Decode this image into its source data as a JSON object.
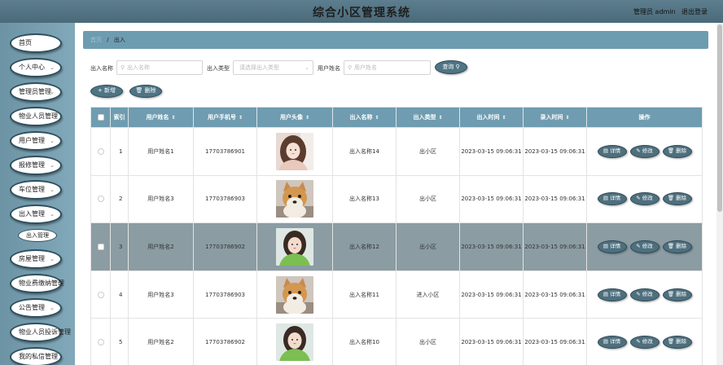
{
  "header": {
    "title": "综合小区管理系统",
    "admin_label": "管理员 admin",
    "logout_label": "退出登录"
  },
  "sidebar": {
    "items": [
      {
        "label": "首页",
        "has_chevron": false
      },
      {
        "label": "个人中心",
        "has_chevron": true
      },
      {
        "label": "管理员管理",
        "has_chevron": true
      },
      {
        "label": "物业人员管理",
        "has_chevron": false
      },
      {
        "label": "用户管理",
        "has_chevron": true
      },
      {
        "label": "报修管理",
        "has_chevron": true
      },
      {
        "label": "车位管理",
        "has_chevron": true
      },
      {
        "label": "出入管理",
        "has_chevron": true
      },
      {
        "label": "房屋管理",
        "has_chevron": true
      },
      {
        "label": "物业费缴纳管理",
        "has_chevron": false
      },
      {
        "label": "公告管理",
        "has_chevron": true
      },
      {
        "label": "物业人员投诉管理",
        "has_chevron": false
      },
      {
        "label": "我的私信管理",
        "has_chevron": false
      }
    ],
    "submenu": {
      "label": "出入管理"
    }
  },
  "breadcrumb": {
    "home": "首页",
    "sep": "/",
    "current": "出入"
  },
  "filters": {
    "name_label": "出入名称",
    "name_placeholder": "出入名称",
    "type_label": "出入类型",
    "type_placeholder": "请选择出入类型",
    "user_label": "用户姓名",
    "user_placeholder": "用户姓名",
    "query_label": "查询"
  },
  "actions": {
    "add_label": "新增",
    "delete_label": "删除"
  },
  "table": {
    "headers": [
      "索引",
      "用户姓名",
      "用户手机号",
      "用户头像",
      "出入名称",
      "出入类型",
      "出入时间",
      "录入时间",
      "操作"
    ],
    "detail_label": "详情",
    "edit_label": "修改",
    "delete_label": "删除",
    "rows": [
      {
        "index": "1",
        "name": "用户姓名1",
        "phone": "17703786901",
        "avatar": "girl",
        "inout_name": "出入名称14",
        "type": "出小区",
        "time": "2023-03-15 09:06:31",
        "record_time": "2023-03-15 09:06:31",
        "selected": false
      },
      {
        "index": "2",
        "name": "用户姓名3",
        "phone": "17703786903",
        "avatar": "dog",
        "inout_name": "出入名称13",
        "type": "出小区",
        "time": "2023-03-15 09:06:31",
        "record_time": "2023-03-15 09:06:31",
        "selected": false
      },
      {
        "index": "3",
        "name": "用户姓名2",
        "phone": "17703786902",
        "avatar": "girl-green",
        "inout_name": "出入名称12",
        "type": "出小区",
        "time": "2023-03-15 09:06:31",
        "record_time": "2023-03-15 09:06:31",
        "selected": true
      },
      {
        "index": "4",
        "name": "用户姓名3",
        "phone": "17703786903",
        "avatar": "dog",
        "inout_name": "出入名称11",
        "type": "进入小区",
        "time": "2023-03-15 09:06:31",
        "record_time": "2023-03-15 09:06:31",
        "selected": false
      },
      {
        "index": "5",
        "name": "用户姓名2",
        "phone": "17703786902",
        "avatar": "girl-green",
        "inout_name": "出入名称10",
        "type": "出小区",
        "time": "2023-03-15 09:06:31",
        "record_time": "2023-03-15 09:06:31",
        "selected": false
      }
    ]
  }
}
